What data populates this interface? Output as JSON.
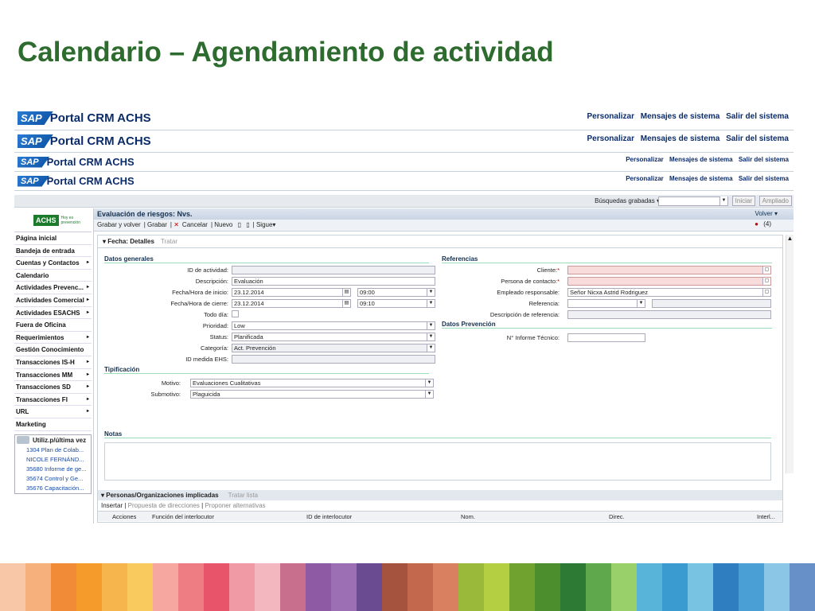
{
  "slide_title": "Calendario – Agendamiento de actividad",
  "headers": [
    {
      "sap": "SAP",
      "title": "Portal CRM ACHS",
      "links": [
        "Personalizar",
        "Mensajes de sistema",
        "Salir del sistema"
      ]
    },
    {
      "sap": "SAP",
      "title": "Portal CRM ACHS",
      "links": [
        "Personalizar",
        "Mensajes de sistema",
        "Salir del sistema"
      ]
    },
    {
      "sap": "SAP",
      "title": "Portal CRM ACHS",
      "links": [
        "Personalizar",
        "Mensajes de sistema",
        "Salir del sistema"
      ]
    },
    {
      "sap": "SAP",
      "title": "Portal CRM ACHS",
      "links": [
        "Personalizar",
        "Mensajes de sistema",
        "Salir del sistema"
      ]
    }
  ],
  "top_toolbar": {
    "saved_searches": "Búsquedas grabadas ▾",
    "start": "Iniciar",
    "advanced": "Ampliado"
  },
  "brand": {
    "logo": "ACHS",
    "sub": "Hoy es prevención"
  },
  "nav": [
    {
      "label": "Página inicial",
      "arrow": ""
    },
    {
      "label": "Bandeja de entrada",
      "arrow": ""
    },
    {
      "label": "Cuentas y Contactos",
      "arrow": "▸"
    },
    {
      "label": "Calendario",
      "arrow": ""
    },
    {
      "label": "Actividades Prevenc...",
      "arrow": "▸"
    },
    {
      "label": "Actividades Comercial",
      "arrow": "▸"
    },
    {
      "label": "Actividades ESACHS",
      "arrow": "▸"
    },
    {
      "label": "Fuera de Oficina",
      "arrow": ""
    },
    {
      "label": "Requerimientos",
      "arrow": "▸"
    },
    {
      "label": "Gestión Conocimiento",
      "arrow": ""
    },
    {
      "label": "Transacciones IS-H",
      "arrow": "▸"
    },
    {
      "label": "Transacciones MM",
      "arrow": "▸"
    },
    {
      "label": "Transacciones SD",
      "arrow": "▸"
    },
    {
      "label": "Transacciones FI",
      "arrow": "▸"
    },
    {
      "label": "URL",
      "arrow": "▸"
    },
    {
      "label": "Marketing",
      "arrow": ""
    }
  ],
  "recent": {
    "title": "Utiliz.p/última vez",
    "items": [
      "1304 Plan de Colab...",
      "NICOLE FERNÁND...",
      "35680 Informe de ge...",
      "35674 Control y Ge...",
      "35676 Capacitación..."
    ]
  },
  "main": {
    "title": "Evaluación de riesgos: Nvs.",
    "back": "Volver ▾",
    "toolbar": [
      "Grabar y volver",
      "Grabar",
      "Cancelar",
      "Nuevo",
      "Sigue▾"
    ],
    "alerts": "(4)",
    "tab": "▾ Fecha: Detalles",
    "tab_action": "Tratar"
  },
  "form": {
    "datos_generales": "Datos generales",
    "referencias": "Referencias",
    "tipificacion": "Tipificación",
    "datos_prevencion": "Datos Prevención",
    "notas": "Notas",
    "labels": {
      "id": "ID de actividad:",
      "desc": "Descripción:",
      "inicio": "Fecha/Hora de inicio:",
      "cierre": "Fecha/Hora de cierre:",
      "todo": "Todo día:",
      "prioridad": "Prioridad:",
      "status": "Status:",
      "categoria": "Categoría:",
      "ehs": "ID medida EHS:",
      "motivo": "Motivo:",
      "submotivo": "Submotivo:",
      "cliente": "Cliente:",
      "persona": "Persona de contacto:",
      "empleado": "Empleado responsable:",
      "referencia": "Referencia:",
      "desc_ref": "Descripción de referencia:",
      "informe": "N° Informe Técnico:"
    },
    "values": {
      "desc": "Evaluación",
      "fecha_inicio": "23.12.2014",
      "hora_inicio": "09:00",
      "fecha_cierre": "23.12.2014",
      "hora_cierre": "09:10",
      "prioridad": "Low",
      "status": "Planificada",
      "categoria": "Act. Prevención",
      "motivo": "Evaluaciones Cualitativas",
      "submotivo": "Plaguicida",
      "empleado": "Señor Nicxa Astrid Rodriguez"
    }
  },
  "personas": {
    "title": "▾ Personas/Organizaciones implicadas",
    "tratar": "Tratar lista",
    "insert": "Insertar",
    "proposal": "Propuesta de direcciones",
    "alternatives": "Proponer alternativas",
    "cols": [
      "Acciones",
      "Función del interlocutor",
      "ID de interlocutor",
      "Nom.",
      "Direc.",
      "Interl..."
    ]
  },
  "stripe_colors": [
    "#f7c7a8",
    "#f5b07c",
    "#f28b38",
    "#f59b2b",
    "#f7b54e",
    "#f9cb5f",
    "#f6a8a0",
    "#ee7d83",
    "#e8556a",
    "#f09aa6",
    "#f3b8bf",
    "#c76f8d",
    "#8f5aa4",
    "#9c6fb4",
    "#6a4a90",
    "#a5523f",
    "#c4684d",
    "#d98060",
    "#9ab83a",
    "#b5cf42",
    "#6fa22f",
    "#4c8d2e",
    "#2d7a35",
    "#5fa84b",
    "#9ad06a",
    "#58b4d8",
    "#3a9bd0",
    "#78c3e2",
    "#2f7fc0",
    "#4a9fd4",
    "#8bc6e6",
    "#6790c8"
  ]
}
